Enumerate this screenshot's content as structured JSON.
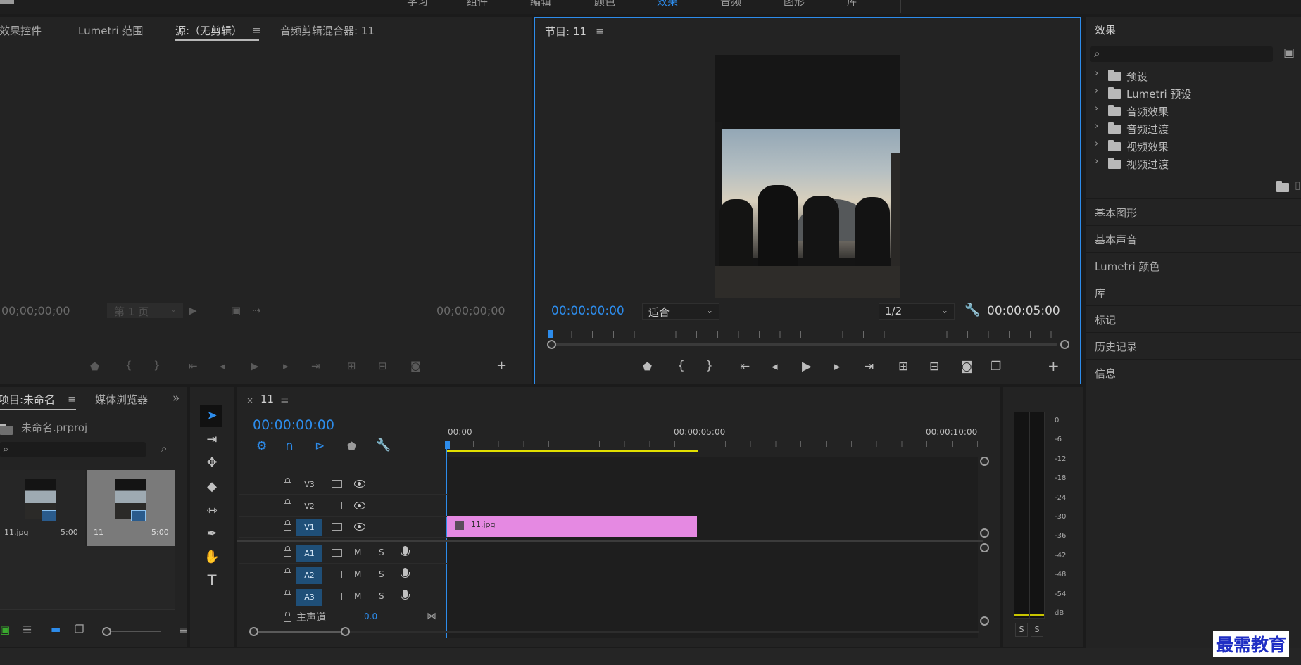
{
  "top_menu": {
    "items": [
      "学习",
      "组件",
      "编辑",
      "颜色",
      "效果",
      "音频",
      "图形",
      "库"
    ],
    "active": "效果"
  },
  "source_panel": {
    "tabs": [
      "效果控件",
      "Lumetri 范围",
      "源:（无剪辑）",
      "音频剪辑混合器: 11"
    ],
    "timecode_left": "00;00;00;00",
    "timecode_right": "00;00;00;00",
    "page_select": "第 1 页"
  },
  "program_panel": {
    "title": "节目: 11",
    "timecode": "00:00:00:00",
    "zoom": "适合",
    "resolution": "1/2",
    "duration": "00:00:05:00"
  },
  "effects_panel": {
    "title": "效果",
    "search_placeholder": "",
    "tree": [
      "预设",
      "Lumetri 预设",
      "音频效果",
      "音频过渡",
      "视频效果",
      "视频过渡"
    ],
    "collapsed": [
      "基本图形",
      "基本声音",
      "Lumetri 颜色",
      "库",
      "标记",
      "历史记录",
      "信息"
    ]
  },
  "project_panel": {
    "tabs": [
      "项目:未命名",
      "媒体浏览器"
    ],
    "project_file": "未命名.prproj",
    "items": [
      {
        "name": "11.jpg",
        "duration": "5:00"
      },
      {
        "name": "11",
        "duration": "5:00"
      }
    ]
  },
  "timeline": {
    "sequence": "11",
    "timecode": "00:00:00:00",
    "ruler": [
      "00:00",
      "00:00:05:00",
      "00:00:10:00"
    ],
    "video_tracks": [
      "V3",
      "V2",
      "V1"
    ],
    "audio_tracks": [
      "A1",
      "A2",
      "A3"
    ],
    "master": {
      "label": "主声道",
      "value": "0.0"
    },
    "clip": {
      "name": "11.jpg",
      "color": "#e589e2"
    },
    "mute": "M",
    "solo": "S"
  },
  "meter": {
    "ticks": [
      "0",
      "-6",
      "-12",
      "-18",
      "-24",
      "-30",
      "-36",
      "-42",
      "-48",
      "-54",
      "dB"
    ],
    "solo_buttons": [
      "S",
      "S"
    ]
  },
  "watermark": "最需教育",
  "colors": {
    "accent": "#2d8ceb",
    "clip": "#e589e2",
    "workarea": "#e2e000"
  }
}
